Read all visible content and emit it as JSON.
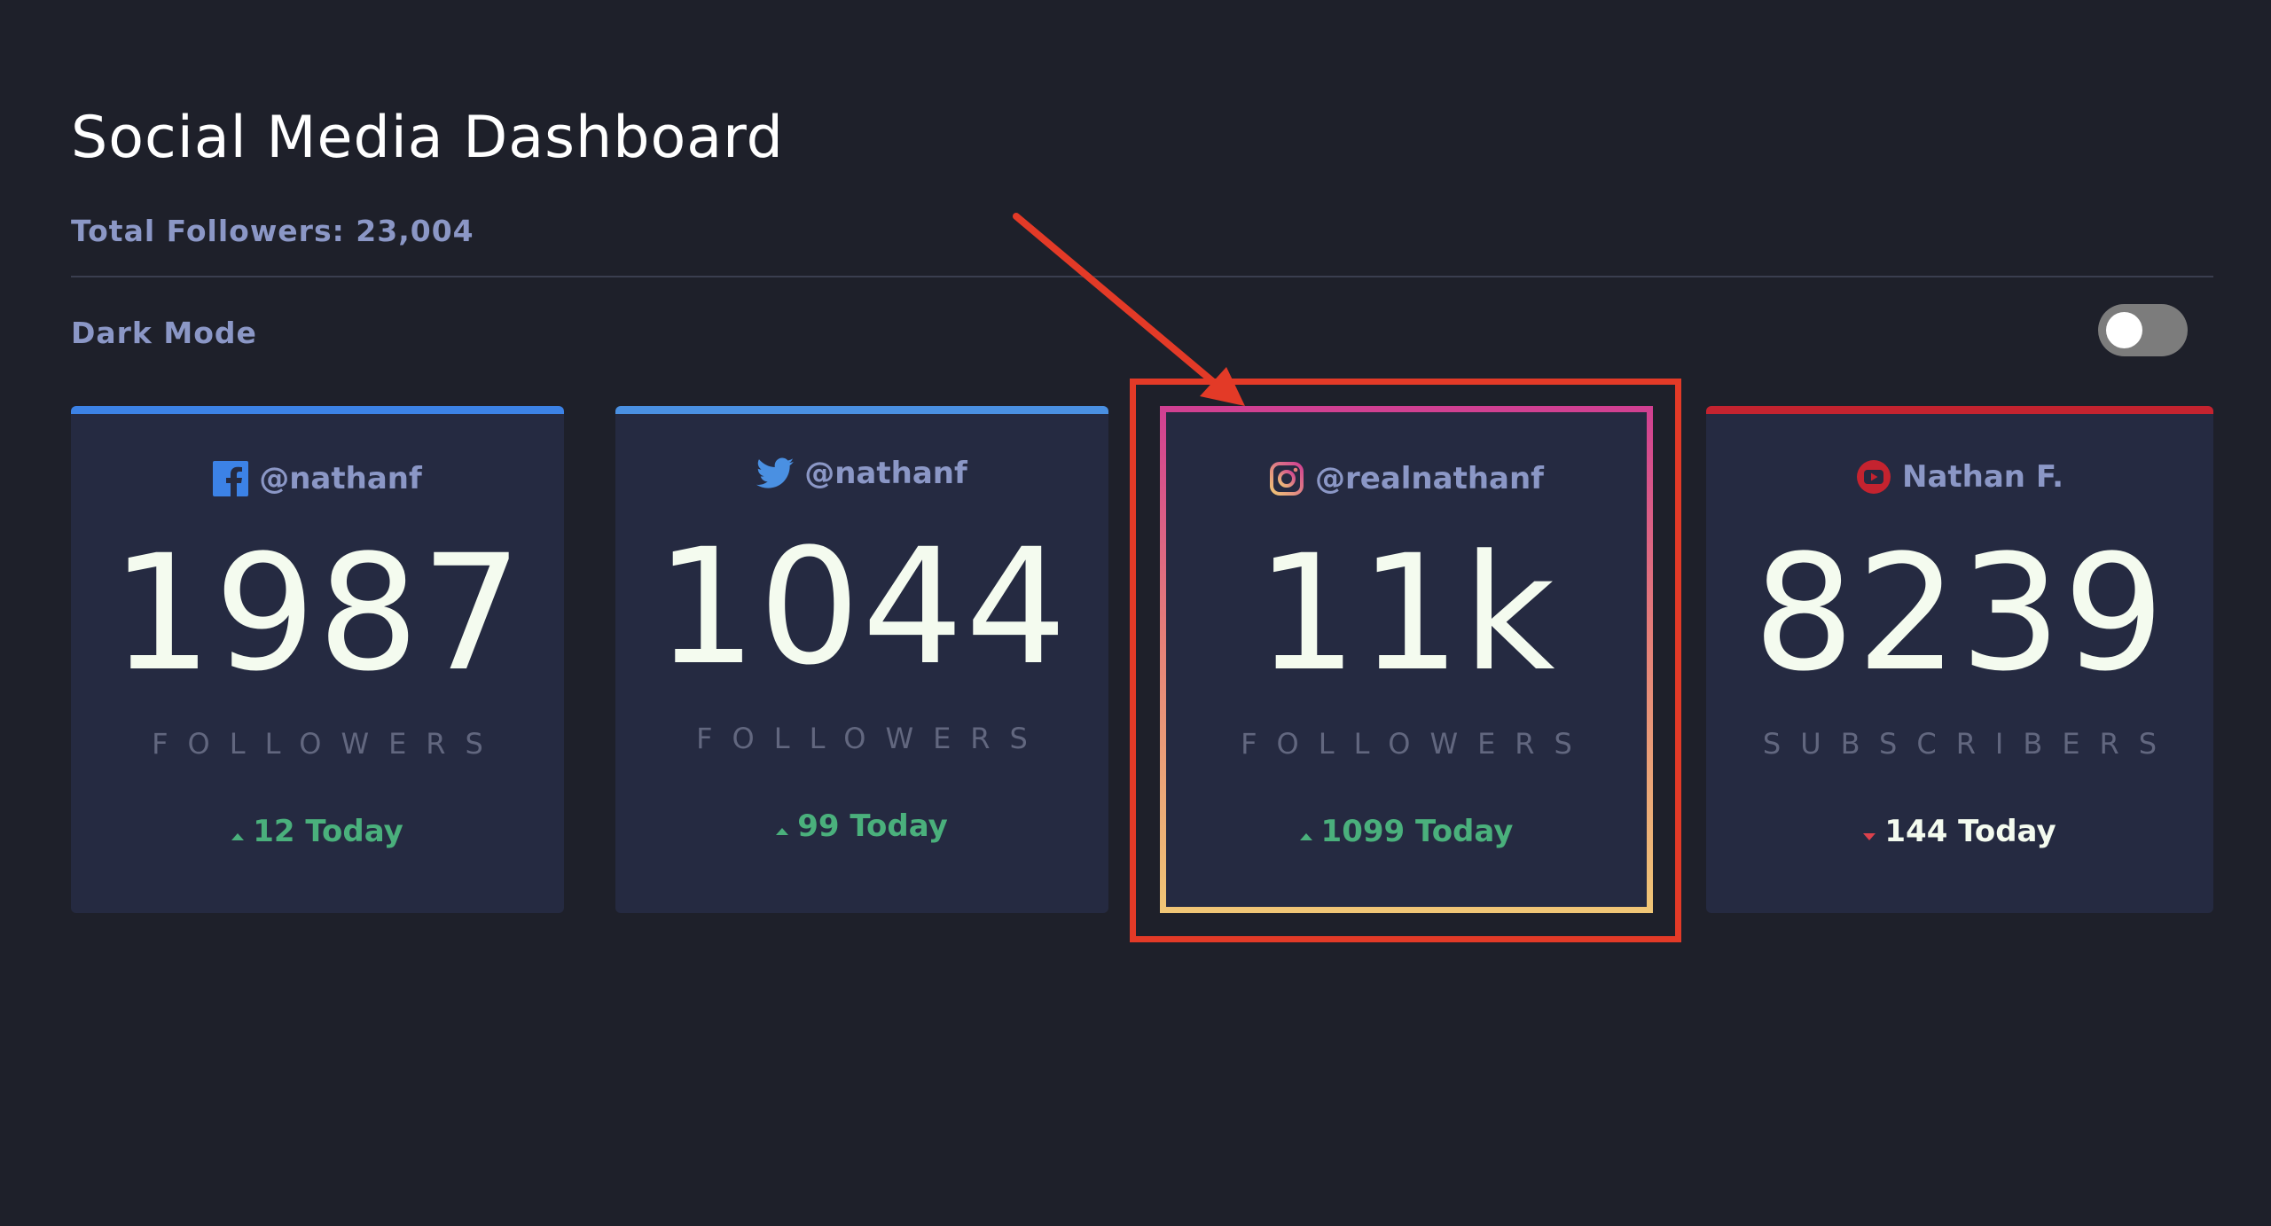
{
  "header": {
    "title": "Social Media Dashboard",
    "total_followers": "Total Followers: 23,004"
  },
  "settings": {
    "dark_mode_label": "Dark Mode",
    "dark_mode_on": false
  },
  "cards": [
    {
      "platform": "facebook",
      "icon": "facebook-icon",
      "handle": "@nathanf",
      "count": "1987",
      "unit": "FOLLOWERS",
      "today": "12 Today",
      "trend": "up",
      "accent": "#3c82e6"
    },
    {
      "platform": "twitter",
      "icon": "twitter-icon",
      "handle": "@nathanf",
      "count": "1044",
      "unit": "FOLLOWERS",
      "today": "99 Today",
      "trend": "up",
      "accent": "#4a90e2"
    },
    {
      "platform": "instagram",
      "icon": "instagram-icon",
      "handle": "@realnathanf",
      "count": "11k",
      "unit": "FOLLOWERS",
      "today": "1099 Today",
      "trend": "up",
      "accent_gradient": [
        "#d03f92",
        "#f0c676"
      ]
    },
    {
      "platform": "youtube",
      "icon": "youtube-icon",
      "handle": "Nathan F.",
      "count": "8239",
      "unit": "SUBSCRIBERS",
      "today": "144 Today",
      "trend": "down",
      "accent": "#c4232f"
    }
  ],
  "colors": {
    "background": "#1e202a",
    "card_background": "#252a41",
    "muted_text": "#8b97c6",
    "positive": "#4ab07c",
    "negative": "#dc414c",
    "annotation": "#e33a27"
  }
}
